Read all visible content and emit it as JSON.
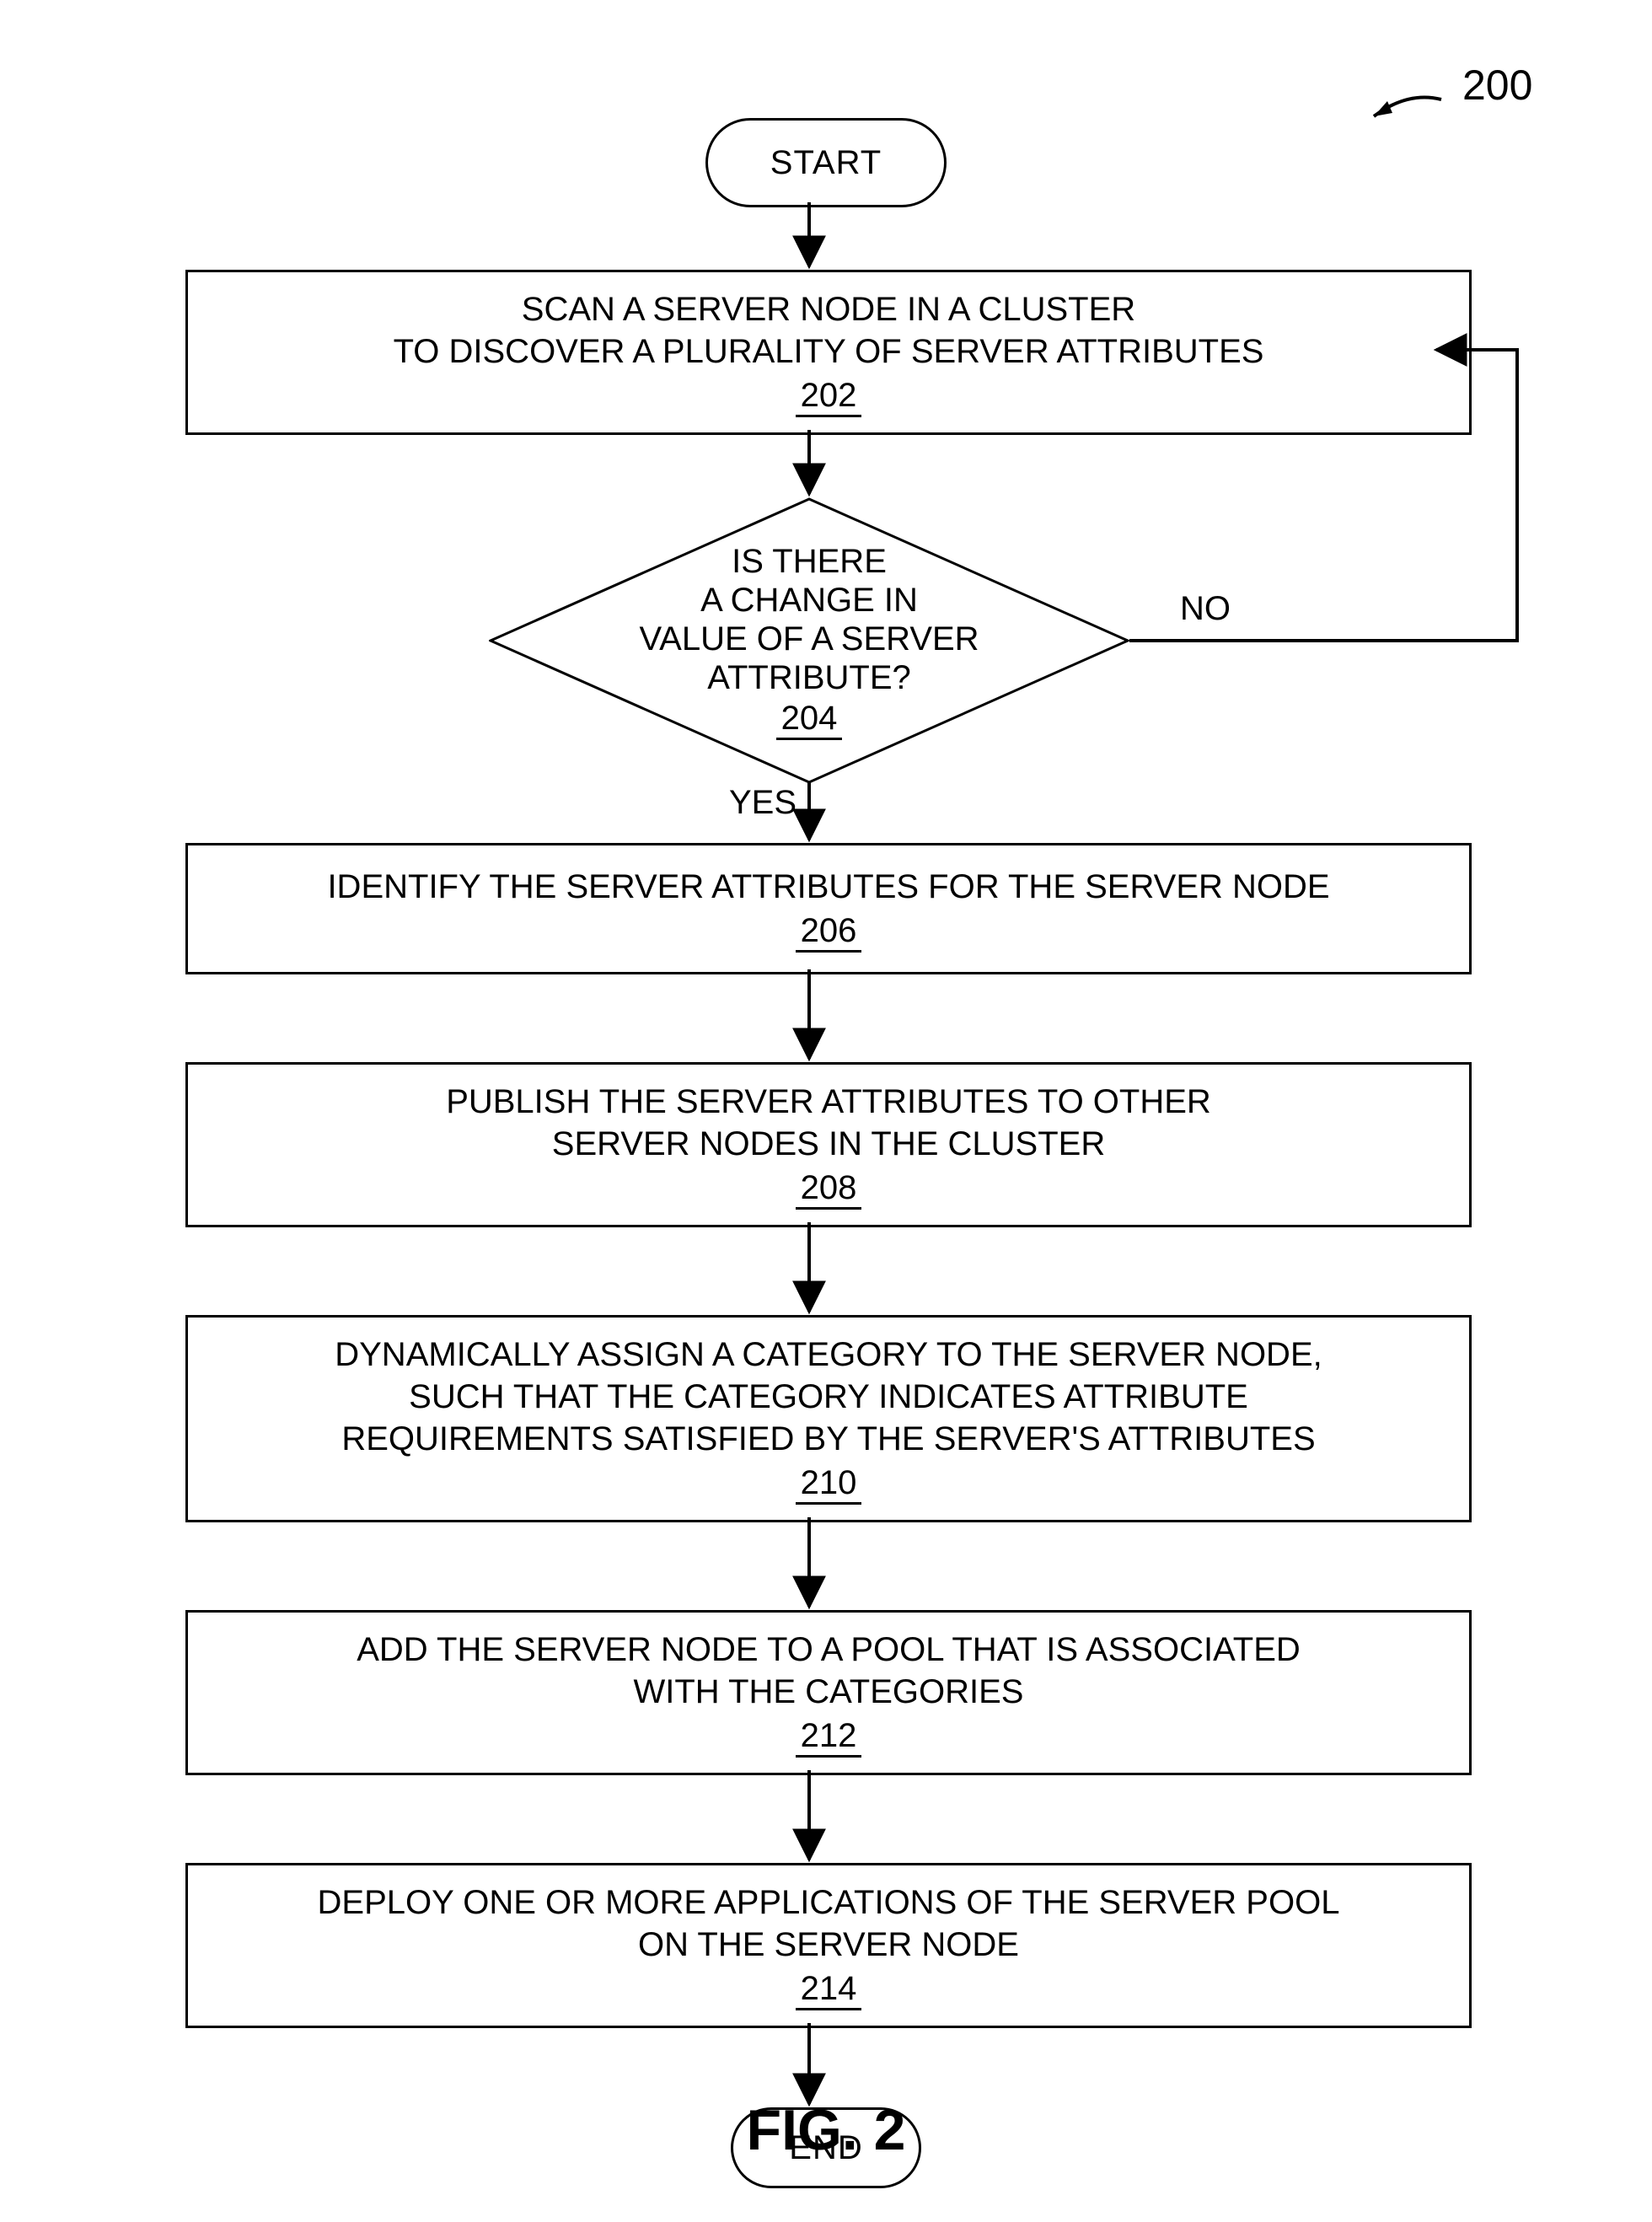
{
  "figure_number": "200",
  "figure_label": "FIG. 2",
  "start_label": "START",
  "end_label": "END",
  "yes_label": "YES",
  "no_label": "NO",
  "step202": {
    "text": "SCAN A SERVER NODE IN A CLUSTER\nTO DISCOVER A PLURALITY OF SERVER ATTRIBUTES",
    "ref": "202"
  },
  "step204": {
    "l1": "IS THERE",
    "l2": "A CHANGE IN",
    "l3": "VALUE OF A SERVER",
    "l4": "ATTRIBUTE?",
    "ref": "204"
  },
  "step206": {
    "text": "IDENTIFY THE SERVER ATTRIBUTES FOR THE SERVER NODE",
    "ref": "206"
  },
  "step208": {
    "text": "PUBLISH THE SERVER ATTRIBUTES TO OTHER\nSERVER NODES IN THE CLUSTER",
    "ref": "208"
  },
  "step210": {
    "text": "DYNAMICALLY ASSIGN A CATEGORY TO THE SERVER NODE,\nSUCH THAT THE CATEGORY INDICATES ATTRIBUTE\nREQUIREMENTS SATISFIED BY THE SERVER'S ATTRIBUTES",
    "ref": "210"
  },
  "step212": {
    "text": "ADD THE SERVER NODE TO A POOL THAT IS ASSOCIATED\nWITH THE CATEGORIES",
    "ref": "212"
  },
  "step214": {
    "text": "DEPLOY ONE OR MORE APPLICATIONS OF THE SERVER POOL\nON THE SERVER NODE",
    "ref": "214"
  }
}
